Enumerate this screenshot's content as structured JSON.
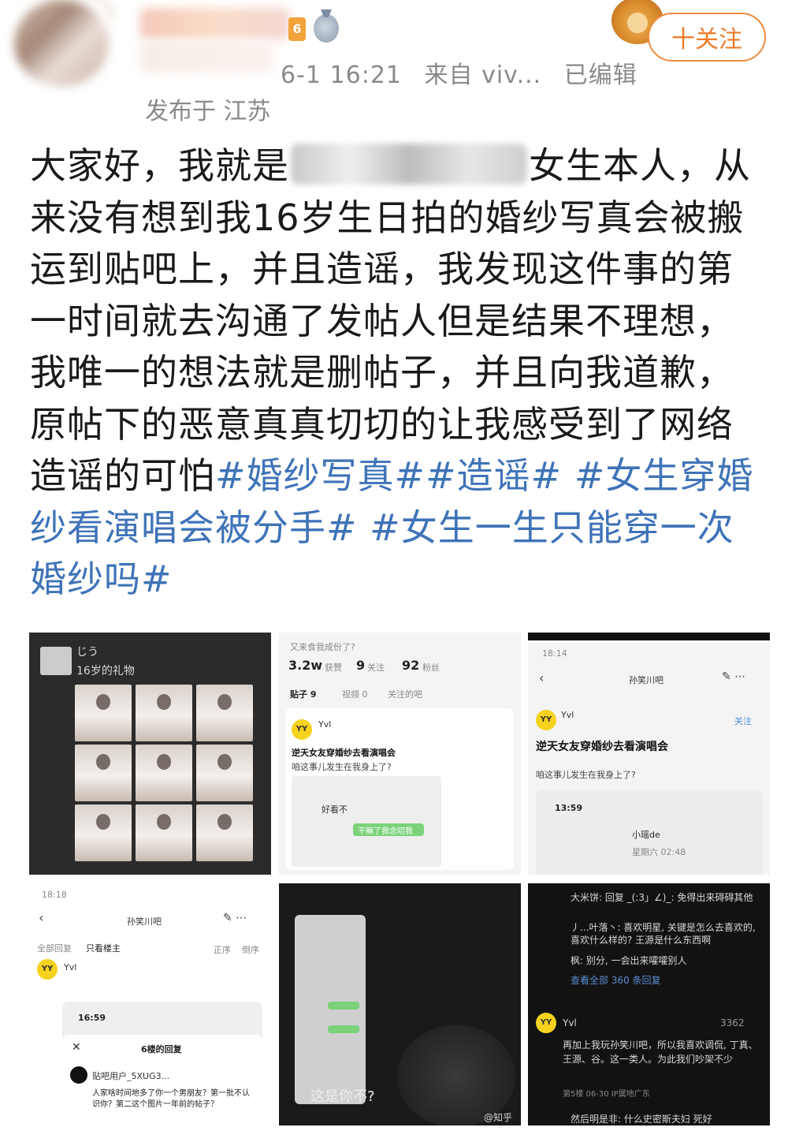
{
  "header": {
    "timestamp": "6-1 16:21",
    "source": "来自 viv...",
    "edited": "已编辑",
    "location": "发布于 江苏",
    "vip_badge": "6",
    "follow_label": "十关注"
  },
  "post": {
    "text_before_redaction": "大家好，我就是",
    "text_after_redaction": "女生本人，从来没有想到我16岁生日拍的婚纱写真会被搬运到贴吧上，并且造谣，我发现这件事的第一时间就去沟通了发帖人但是结果不理想，我唯一的想法就是删帖子，并且向我道歉，原帖下的恶意真真切切的让我感受到了网络造谣的可怕",
    "hashtags": [
      "#婚纱写真#",
      "#造谣#",
      "#女生穿婚纱看演唱会被分手#",
      "#女生一生只能穿一次婚纱吗#"
    ],
    "colors": {
      "text": "#1a1a1a",
      "hashtag": "#3f73b8",
      "meta": "#8a8a8a",
      "follow": "#f07c2a"
    }
  },
  "images": {
    "t1": {
      "caption": "16岁的礼物",
      "handle": "じう"
    },
    "t2": {
      "top": "又来食我成份了?",
      "followers": "3.2w",
      "followers_label": "获赞",
      "following": "9",
      "following_label": "关注",
      "fans": "92",
      "fans_label": "粉丝",
      "tab1": "贴子 9",
      "tab2": "视频 0",
      "tab3": "关注的吧",
      "user": "Yvl",
      "post_title": "逆天女友穿婚纱去看演唱会",
      "post_sub": "咱这事儿发生在我身上了?",
      "reply": "好看不",
      "green_reply": "干嘛了我念叨我"
    },
    "t3": {
      "time": "18:14",
      "bar": "孙笑川吧",
      "user": "Yvl",
      "follow": "关注",
      "title": "逆天女友穿婚纱去看演唱会",
      "sub": "咱这事儿发生在我身上了?",
      "inner_time": "13:59",
      "inner_name": "小瑶de",
      "inner_sub": "星期六 02:48"
    },
    "t4": {
      "time": "18:18",
      "bar": "孙笑川吧",
      "tab_all": "全部回复",
      "tab_op": "只看楼主",
      "sort1": "正序",
      "sort2": "倒序",
      "user": "Yvl",
      "inner_time": "16:59",
      "reply_title": "6楼的回复",
      "commenter": "贴吧用户_5XUG3...",
      "comment": "人家啥时间地多了你一个男朋友？第一批不认识你？第二这个图片一年前的帖子？"
    },
    "t5": {
      "caption": "这是你不?",
      "watermark": "@知乎"
    },
    "t6": {
      "c1": "大米饼: 回复 _(:3」∠)_: 免得出来碍碍其他",
      "c2": "丿...叶落丶: 喜欢明星, 关键是怎么去喜欢的, 喜欢什么样的? 王源是什么东西啊",
      "c3": "枫: 别分, 一会出来嚯嚯别人",
      "more": "查看全部 360 条回复",
      "user": "Yvl",
      "likes": "3362",
      "body": "再加上我玩孙笑川吧，所以我喜欢调侃, 丁真、王源、谷。这一类人。为此我们吵架不少",
      "floor": "第5楼  06-30  IP属地广东",
      "bottom": "然后明是非: 什么史密斯夫妇 死好"
    }
  }
}
